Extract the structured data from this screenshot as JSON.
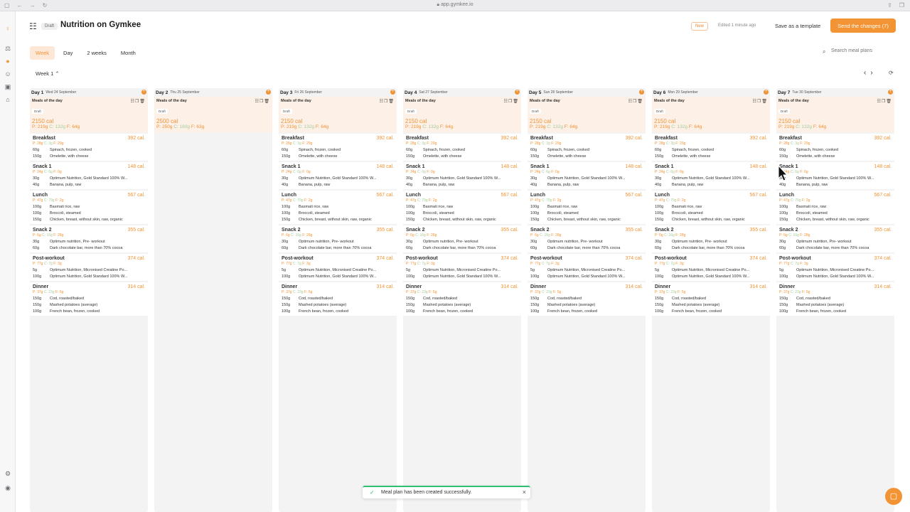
{
  "browser": {
    "url": "app.gymkee.io"
  },
  "header": {
    "draft_badge": "Draft",
    "title": "Nutrition on Gymkee",
    "new_badge": "New",
    "edited": "Edited 1 minute ago",
    "save_template": "Save as a template",
    "send_changes": "Send the changes (7)"
  },
  "tabs": [
    "Week",
    "Day",
    "2 weeks",
    "Month"
  ],
  "search": {
    "placeholder": "Search meal plans"
  },
  "week_selector": "Week 1 ⌃",
  "days": [
    {
      "label": "Day 1",
      "date": "Wed 24 September"
    },
    {
      "label": "Day 2",
      "date": "Thu 25 September"
    },
    {
      "label": "Day 3",
      "date": "Fri 26 September"
    },
    {
      "label": "Day 4",
      "date": "Sat 27 September"
    },
    {
      "label": "Day 5",
      "date": "Sun 28 September"
    },
    {
      "label": "Day 6",
      "date": "Mon 29 September"
    },
    {
      "label": "Day 7",
      "date": "Tue 30 September"
    }
  ],
  "plan": {
    "label": "Meals of the day",
    "draft": "Draft",
    "kcal": "2150 cal",
    "p": "P: 219g",
    "c": "C: 132g",
    "f": "F: 64g"
  },
  "plan_day2": {
    "kcal": "2500 cal",
    "p": "P: 250g",
    "c": "C: 180g",
    "f": "F: 63g"
  },
  "meals": [
    {
      "name": "Breakfast",
      "cal": "392 cal.",
      "p": "P: 28g",
      "c": "C: 3g",
      "f": "F: 29g",
      "items": [
        {
          "q": "60g",
          "n": "Spinach, frozen, cooked"
        },
        {
          "q": "150g",
          "n": "Omelette, with cheese"
        }
      ]
    },
    {
      "name": "Snack 1",
      "cal": "148 cal.",
      "p": "P: 24g",
      "c": "C: 6g",
      "f": "F: 0g",
      "items": [
        {
          "q": "30g",
          "n": "Optimum Nutrition, Gold Standard 100% W..."
        },
        {
          "q": "40g",
          "n": "Banana, pulp, raw"
        }
      ]
    },
    {
      "name": "Lunch",
      "cal": "567 cal.",
      "p": "P: 47g",
      "c": "C: 79g",
      "f": "F: 2g",
      "items": [
        {
          "q": "100g",
          "n": "Basmati rice, raw"
        },
        {
          "q": "100g",
          "n": "Broccoli, steamed"
        },
        {
          "q": "150g",
          "n": "Chicken, breast, without skin, raw, organic"
        }
      ]
    },
    {
      "name": "Snack 2",
      "cal": "355 cal.",
      "p": "P: 6g",
      "c": "C: 16g",
      "f": "F: 28g",
      "items": [
        {
          "q": "30g",
          "n": "Optimum nutrition, Pre- workout"
        },
        {
          "q": "60g",
          "n": "Dark chocolate bar, more than 70% cocoa"
        }
      ]
    },
    {
      "name": "Post-workout",
      "cal": "374 cal.",
      "p": "P: 77g",
      "c": "C: 7g",
      "f": "F: 3g",
      "items": [
        {
          "q": "5g",
          "n": "Optimum Nutrition, Micronised Creatine Po..."
        },
        {
          "q": "100g",
          "n": "Optimum Nutrition, Gold Standard 100% W..."
        }
      ]
    },
    {
      "name": "Dinner",
      "cal": "314 cal.",
      "p": "P: 37g",
      "c": "C: 23g",
      "f": "F: 5g",
      "items": [
        {
          "q": "150g",
          "n": "Cod, roasted/baked"
        },
        {
          "q": "150g",
          "n": "Mashed potatoes (average)"
        },
        {
          "q": "100g",
          "n": "French bean, frozen, cooked"
        }
      ]
    }
  ],
  "toast": {
    "message": "Meal plan has been created successfully."
  },
  "colors": {
    "accent": "#f29334",
    "success": "#2fbf71",
    "carb": "#a6cb9a"
  }
}
